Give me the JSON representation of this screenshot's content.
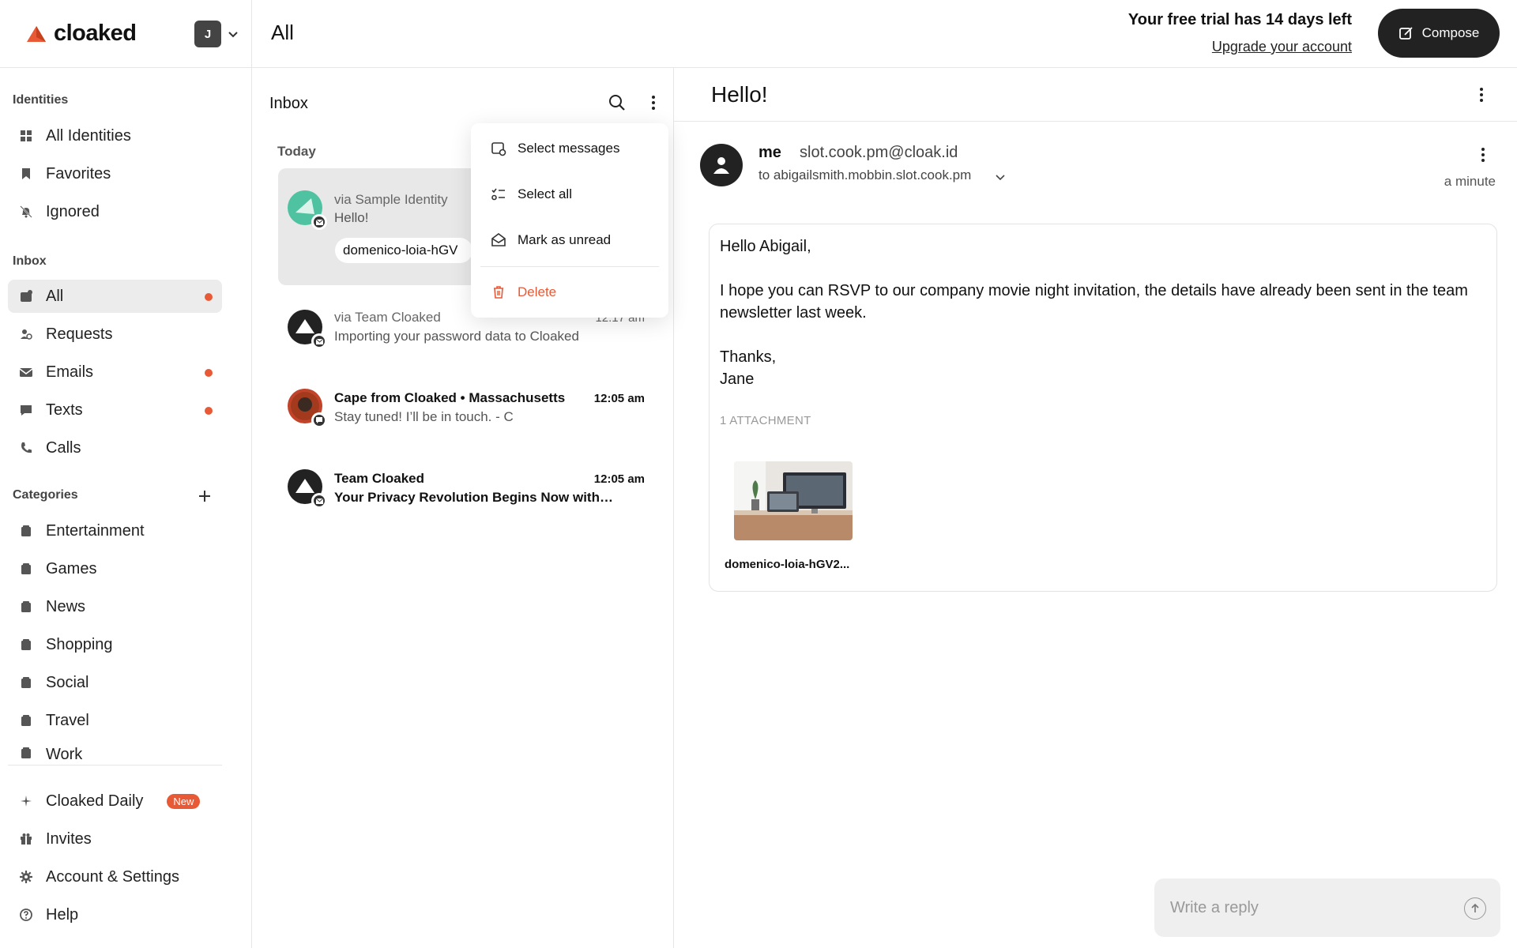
{
  "app": {
    "brand": "cloaked",
    "account_initial": "J",
    "page_title": "All",
    "trial_text": "Your free trial has 14 days left",
    "upgrade_link": "Upgrade your account",
    "compose_label": "Compose"
  },
  "sidebar": {
    "identities_title": "Identities",
    "identities": [
      {
        "label": "All Identities",
        "icon": "grid-icon"
      },
      {
        "label": "Favorites",
        "icon": "bookmark-icon"
      },
      {
        "label": "Ignored",
        "icon": "bell-off-icon"
      }
    ],
    "inbox_title": "Inbox",
    "inbox": [
      {
        "label": "All",
        "icon": "inbox-icon",
        "active": true,
        "unread": true
      },
      {
        "label": "Requests",
        "icon": "requests-icon",
        "unread": false
      },
      {
        "label": "Emails",
        "icon": "mail-icon",
        "unread": true
      },
      {
        "label": "Texts",
        "icon": "chat-icon",
        "unread": true
      },
      {
        "label": "Calls",
        "icon": "phone-icon",
        "unread": false
      }
    ],
    "categories_title": "Categories",
    "categories": [
      "Entertainment",
      "Games",
      "News",
      "Shopping",
      "Social",
      "Travel",
      "Work"
    ],
    "footer": [
      {
        "label": "Cloaked Daily",
        "icon": "sparkle-icon",
        "badge": "New"
      },
      {
        "label": "Invites",
        "icon": "gift-icon"
      },
      {
        "label": "Account & Settings",
        "icon": "gear-icon"
      },
      {
        "label": "Help",
        "icon": "help-icon"
      }
    ]
  },
  "inbox_list": {
    "title": "Inbox",
    "group_label": "Today",
    "messages": [
      {
        "from": "via Sample Identity",
        "subject": "Hello!",
        "time": "",
        "attachment_chip": "domenico-loia-hGV",
        "bold": false,
        "selected": true
      },
      {
        "from": "via Team Cloaked",
        "subject": "Importing your password data to Cloaked",
        "time": "12:17 am",
        "bold": false,
        "selected": false
      },
      {
        "from": "Cape from Cloaked • Massachusetts",
        "subject": "Stay tuned! I’ll be in touch. - C",
        "time": "12:05 am",
        "bold": true,
        "selected": false
      },
      {
        "from": "Team Cloaked",
        "subject": "Your Privacy Revolution Begins Now with…",
        "time": "12:05 am",
        "bold": true,
        "selected": false
      }
    ]
  },
  "dropdown": {
    "items": [
      "Select messages",
      "Select all",
      "Mark as unread"
    ],
    "delete_label": "Delete"
  },
  "reader": {
    "title": "Hello!",
    "sender_name": "me",
    "sender_email": "slot.cook.pm@cloak.id",
    "to_line": "to abigailsmith.mobbin.slot.cook.pm",
    "time": "a minute",
    "body": {
      "greeting": "Hello Abigail,",
      "paragraph": "I hope you can RSVP to our company movie night invitation, the details have already been sent in the team newsletter last week.",
      "signoff": "Thanks,",
      "signature": "Jane"
    },
    "attachment_label": "1 ATTACHMENT",
    "attachment_name": "domenico-loia-hGV2...",
    "reply_placeholder": "Write a reply"
  },
  "colors": {
    "accent": "#e85a36",
    "dark": "#222222",
    "selected_bg": "#e8e8e8"
  }
}
